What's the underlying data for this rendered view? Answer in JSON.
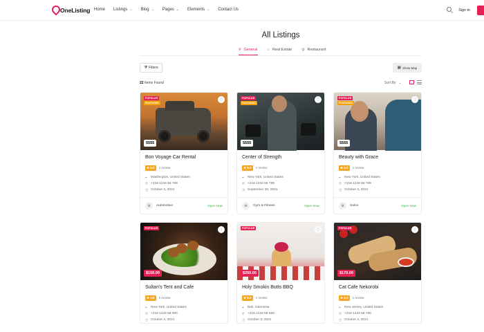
{
  "brand": {
    "name": "OneListing",
    "accent": "#e61f55"
  },
  "nav": [
    {
      "label": "Home",
      "dropdown": false
    },
    {
      "label": "Listings",
      "dropdown": true
    },
    {
      "label": "Blog",
      "dropdown": true
    },
    {
      "label": "Pages",
      "dropdown": true
    },
    {
      "label": "Elements",
      "dropdown": true
    },
    {
      "label": "Contact Us",
      "dropdown": false
    }
  ],
  "header": {
    "signin_label": "Sign in"
  },
  "page": {
    "title": "All Listings"
  },
  "tabs": [
    {
      "label": "General",
      "icon": "pin-icon",
      "active": true
    },
    {
      "label": "Real Estate",
      "icon": "home-icon",
      "active": false
    },
    {
      "label": "Restaurant",
      "icon": "fork-knife-icon",
      "active": false
    }
  ],
  "toolbar": {
    "filters_label": "Filters",
    "show_map_label": "Show Map",
    "items_count": "22",
    "items_found_label": "Items Found",
    "sort_label": "Sort By"
  },
  "listings": [
    {
      "title": "Bon Voyage Car Rental",
      "rating": "5.0",
      "reviews": "1 review",
      "address": "Washington, United States",
      "phone": "+218 1234 56 789",
      "date": "October 3, 2021",
      "category": "Automotive",
      "status": "Open Now",
      "price": "$$$$",
      "badges": [
        "POPULAR",
        "FEATURED"
      ],
      "scene": "car"
    },
    {
      "title": "Center of Strength",
      "rating": "5.0",
      "reviews": "1 review",
      "address": "New York, United States",
      "phone": "+218 1234 56 789",
      "date": "September 30, 2021",
      "category": "Gym & Fitness",
      "status": "Open Now",
      "price": "$$$$",
      "badges": [
        "POPULAR",
        "FEATURED"
      ],
      "scene": "gym"
    },
    {
      "title": "Beauty with Grace",
      "rating": "5.0",
      "reviews": "1 review",
      "address": "New York, United States",
      "phone": "+218 1234 56 789",
      "date": "October 3, 2021",
      "category": "Salon",
      "status": "Open Now",
      "price": "$$$$",
      "badges": [
        "POPULAR",
        "FEATURED"
      ],
      "scene": "barber"
    },
    {
      "title": "Sultan's Tent and Cafe",
      "rating": "4.8",
      "reviews": "2 review",
      "address": "New York, United States",
      "phone": "+216 1234 56 000",
      "date": "October 3, 2021",
      "category": "",
      "status": "",
      "price": "$150.00",
      "badges": [
        "POPULAR"
      ],
      "scene": "food1"
    },
    {
      "title": "Holy Smokin Butts BBQ",
      "rating": "5.0",
      "reviews": "1 review",
      "address": "Bali, Indonesia",
      "phone": "+216 1234 56 555",
      "date": "October 3, 2021",
      "category": "",
      "status": "",
      "price": "$250.00",
      "badges": [
        "POPULAR"
      ],
      "scene": "bbq"
    },
    {
      "title": "Cat Cafe Nekorobi",
      "rating": "5.0",
      "reviews": "1 review",
      "address": "New Jersey, United States",
      "phone": "+216 1234 56 789",
      "date": "October 3, 2021",
      "category": "",
      "status": "",
      "price": "$170.00",
      "badges": [
        "POPULAR"
      ],
      "scene": "cafe"
    }
  ]
}
